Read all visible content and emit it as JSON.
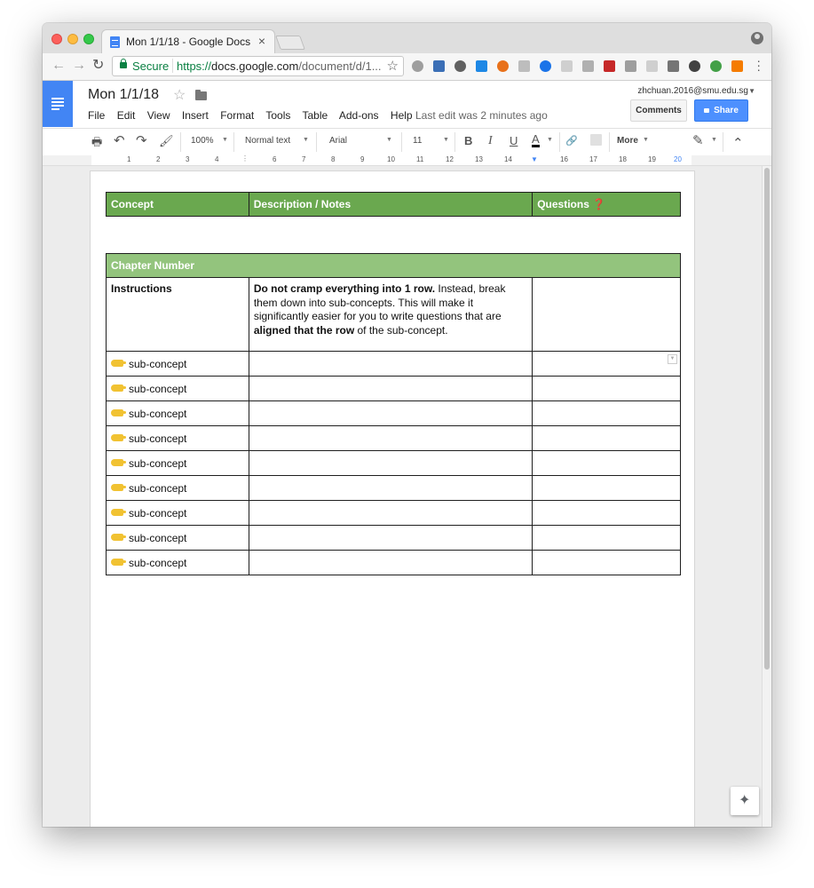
{
  "browser": {
    "tab_title": "Mon 1/1/18 - Google Docs",
    "tab_close": "×",
    "secure_label": "Secure",
    "url_scheme": "https://",
    "url_host": "docs.google.com",
    "url_path": "/document/d/1...",
    "back": "←",
    "forward": "→",
    "reload": "↻",
    "star": "☆"
  },
  "docs": {
    "title": "Mon 1/1/18",
    "title_star": "☆",
    "menu": [
      "File",
      "Edit",
      "View",
      "Insert",
      "Format",
      "Tools",
      "Table",
      "Add-ons",
      "Help"
    ],
    "last_edit": "Last edit was 2 minutes ago",
    "account_email": "zhchuan.2016@smu.edu.sg",
    "comments_label": "Comments",
    "share_label": "Share"
  },
  "toolbar": {
    "zoom": "100%",
    "style": "Normal text",
    "font": "Arial",
    "size": "11",
    "bold": "B",
    "italic": "I",
    "underline": "U",
    "text_color": "A",
    "more": "More",
    "print": "🖶",
    "undo": "↶",
    "redo": "↷",
    "paint": "🖌",
    "link": "🔗",
    "edit_mode": "✎",
    "collapse": "⌃"
  },
  "ruler": [
    "1",
    "2",
    "3",
    "4",
    "6",
    "7",
    "8",
    "9",
    "10",
    "11",
    "12",
    "13",
    "14",
    "16",
    "17",
    "18",
    "19",
    "20"
  ],
  "table1": {
    "headers": [
      "Concept",
      "Description / Notes",
      "Questions"
    ],
    "question_mark": "❓"
  },
  "table2": {
    "chapter": "Chapter Number",
    "instructions_label": "Instructions",
    "instr_bold1": "Do not cramp everything into 1 row.",
    "instr_text1": " Instead, break them down into sub-concepts. This will make it significantly easier for you to write questions that are ",
    "instr_bold2": "aligned that the row",
    "instr_text2": " of the sub-concept.",
    "rows": [
      "sub-concept",
      "sub-concept",
      "sub-concept",
      "sub-concept",
      "sub-concept",
      "sub-concept",
      "sub-concept",
      "sub-concept",
      "sub-concept"
    ]
  },
  "colors": {
    "header_green": "#6aa84f",
    "chapter_green": "#93c47d",
    "docs_blue": "#4285f4",
    "share_blue": "#4d90fe"
  }
}
